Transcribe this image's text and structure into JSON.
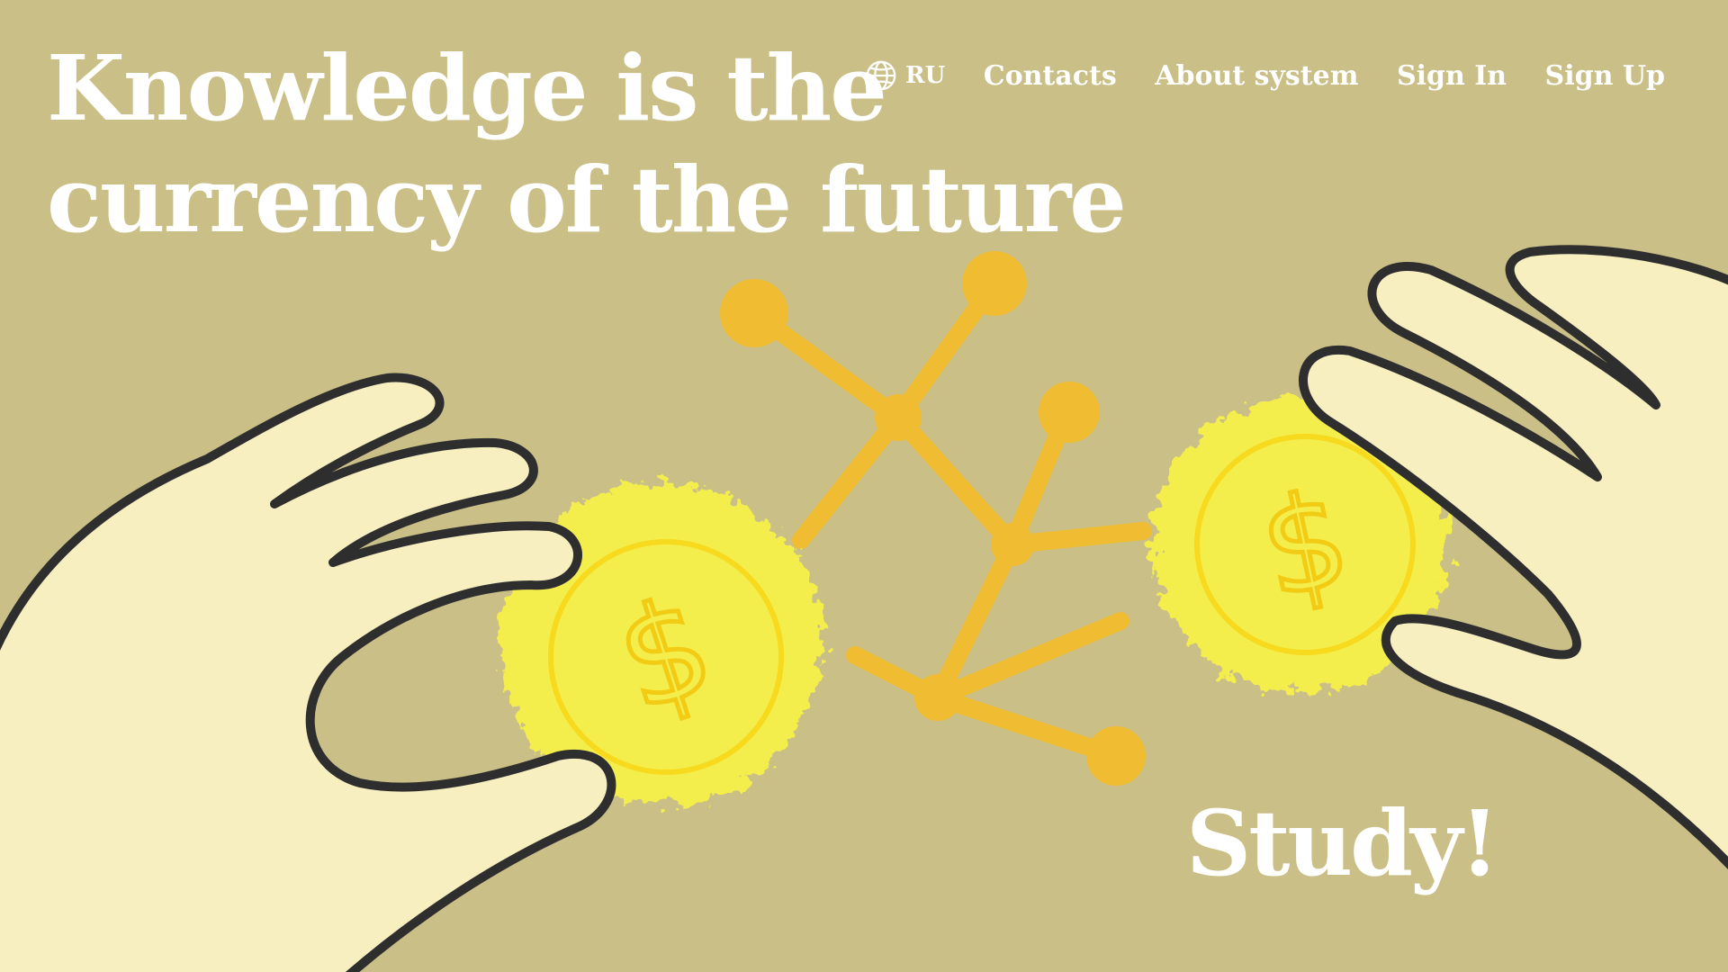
{
  "hero": {
    "line1": "Knowledge is the",
    "line2": "currency of the future"
  },
  "nav": {
    "language": "RU",
    "contacts": "Contacts",
    "about": "About system",
    "sign_in": "Sign In",
    "sign_up": "Sign Up"
  },
  "cta": {
    "label": "Study!"
  },
  "icons": {
    "language": "globe-icon",
    "coin": "dollar-sign"
  },
  "colors": {
    "background": "#c9bf87",
    "hand_fill": "#f8efc0",
    "hand_outline": "#2e2e2e",
    "coin_glow": "#f4ee4e",
    "coin": "#f7d91d",
    "network": "#f0bd32",
    "text": "#ffffff"
  }
}
